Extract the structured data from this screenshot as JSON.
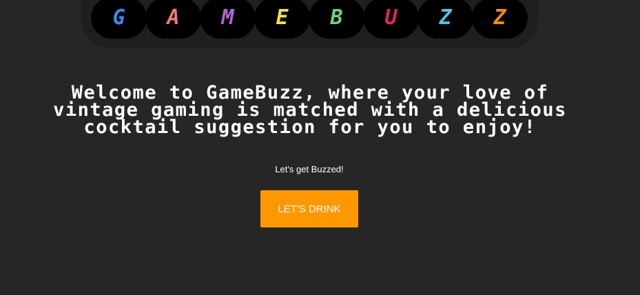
{
  "logo": {
    "letters": [
      {
        "char": "G",
        "color": "#3d8bf2"
      },
      {
        "char": "A",
        "color": "#f07a7a"
      },
      {
        "char": "M",
        "color": "#b266d6"
      },
      {
        "char": "E",
        "color": "#f5e13a"
      },
      {
        "char": "B",
        "color": "#6fcf7f"
      },
      {
        "char": "U",
        "color": "#e0245e"
      },
      {
        "char": "Z",
        "color": "#4fc3e6"
      },
      {
        "char": "Z",
        "color": "#ff8a00"
      }
    ]
  },
  "hero": {
    "headline": "Welcome to GameBuzz, where your love of vintage gaming is matched with a delicious cocktail suggestion for you to enjoy!",
    "tagline": "Let's get Buzzed!",
    "cta_label": "LET'S DRINK"
  },
  "colors": {
    "background": "#262626",
    "accent": "#ff9800"
  }
}
